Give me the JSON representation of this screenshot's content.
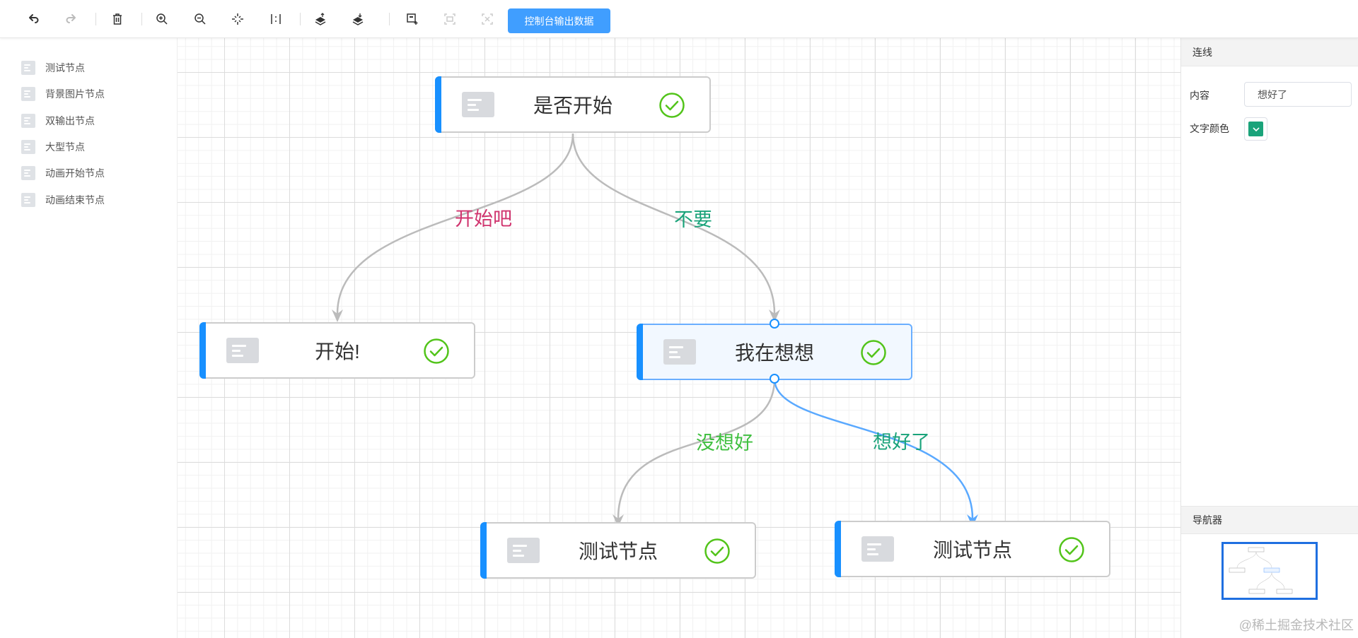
{
  "toolbar": {
    "buttons": [
      {
        "name": "undo-button",
        "icon": "undo-icon",
        "enabled": true
      },
      {
        "name": "redo-button",
        "icon": "redo-icon",
        "enabled": false
      },
      {
        "name": "delete-button",
        "icon": "trash-icon",
        "enabled": true
      },
      {
        "name": "zoom-in-button",
        "icon": "zoom-in-icon",
        "enabled": true
      },
      {
        "name": "zoom-out-button",
        "icon": "zoom-out-icon",
        "enabled": true
      },
      {
        "name": "fit-button",
        "icon": "fit-center-icon",
        "enabled": true
      },
      {
        "name": "actual-size-button",
        "icon": "actual-size-icon",
        "enabled": true
      },
      {
        "name": "to-front-button",
        "icon": "bring-to-front-icon",
        "enabled": true
      },
      {
        "name": "to-back-button",
        "icon": "send-to-back-icon",
        "enabled": true
      },
      {
        "name": "select-all-button",
        "icon": "select-icon",
        "enabled": true
      },
      {
        "name": "group-button",
        "icon": "group-icon",
        "enabled": false
      },
      {
        "name": "ungroup-button",
        "icon": "ungroup-icon",
        "enabled": false
      }
    ],
    "console_label": "控制台输出数据"
  },
  "sidebar": {
    "items": [
      {
        "label": "测试节点",
        "icon": "node-icon"
      },
      {
        "label": "背景图片节点",
        "icon": "node-icon"
      },
      {
        "label": "双输出节点",
        "icon": "node-icon"
      },
      {
        "label": "大型节点",
        "icon": "node-icon"
      },
      {
        "label": "动画开始节点",
        "icon": "node-icon"
      },
      {
        "label": "动画结束节点",
        "icon": "node-icon"
      }
    ]
  },
  "graph": {
    "nodes": [
      {
        "id": "n1",
        "title": "是否开始",
        "status_icon": "check-circle-icon",
        "selected": false
      },
      {
        "id": "n2",
        "title": "开始!",
        "status_icon": "check-circle-icon",
        "selected": false
      },
      {
        "id": "n3",
        "title": "我在想想",
        "status_icon": "check-circle-icon",
        "selected": true
      },
      {
        "id": "n4",
        "title": "测试节点",
        "status_icon": "check-circle-icon",
        "selected": false
      },
      {
        "id": "n5",
        "title": "测试节点",
        "status_icon": "check-circle-icon",
        "selected": false
      }
    ],
    "edges": [
      {
        "from": "n1",
        "to": "n2",
        "label": "开始吧",
        "label_color": "#d0346e",
        "selected": false
      },
      {
        "from": "n1",
        "to": "n3",
        "label": "不要",
        "label_color": "#1aa37a",
        "selected": false
      },
      {
        "from": "n3",
        "to": "n4",
        "label": "没想好",
        "label_color": "#3fbf3f",
        "selected": false
      },
      {
        "from": "n3",
        "to": "n5",
        "label": "想好了",
        "label_color": "#1aa37a",
        "selected": true
      }
    ],
    "colors": {
      "node_accent": "#1890ff",
      "check": "#52c41a",
      "edge": "#bbbbbb",
      "edge_selected": "#5aa9ff"
    }
  },
  "panel": {
    "title": "连线",
    "content_label": "内容",
    "content_value": "想好了",
    "text_color_label": "文字颜色",
    "text_color_value": "#1aa37a",
    "navigator_title": "导航器"
  },
  "watermark": "@稀土掘金技术社区"
}
